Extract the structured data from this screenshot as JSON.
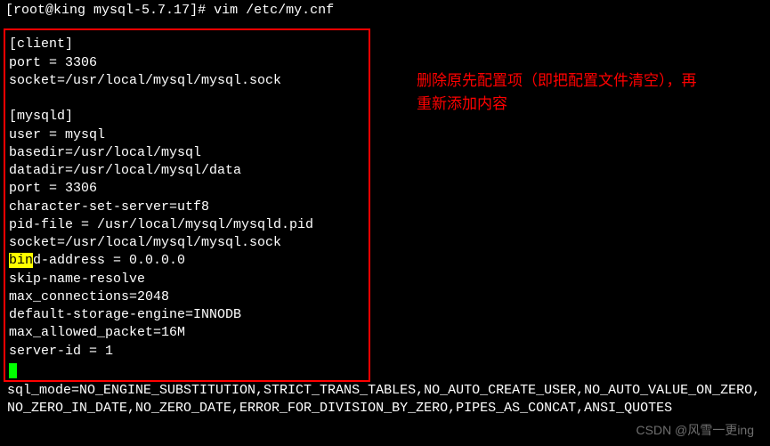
{
  "prompt": {
    "user_host": "root@king",
    "cwd": "mysql-5.7.17",
    "command": "vim /etc/my.cnf"
  },
  "config": {
    "lines": [
      "[client]",
      "port = 3306",
      "socket=/usr/local/mysql/mysql.sock",
      "",
      "[mysqld]",
      "user = mysql",
      "basedir=/usr/local/mysql",
      "datadir=/usr/local/mysql/data",
      "port = 3306",
      "character-set-server=utf8",
      "pid-file = /usr/local/mysql/mysqld.pid",
      "socket=/usr/local/mysql/mysql.sock"
    ],
    "bind_hl": "bin",
    "bind_rest": "d-address = 0.0.0.0",
    "lines_after": [
      "skip-name-resolve",
      "max_connections=2048",
      "default-storage-engine=INNODB",
      "max_allowed_packet=16M",
      "server-id = 1"
    ],
    "sql_mode": "sql_mode=NO_ENGINE_SUBSTITUTION,STRICT_TRANS_TABLES,NO_AUTO_CREATE_USER,NO_AUTO_VALUE_ON_ZERO,NO_ZERO_IN_DATE,NO_ZERO_DATE,ERROR_FOR_DIVISION_BY_ZERO,PIPES_AS_CONCAT,ANSI_QUOTES"
  },
  "annotation": {
    "line1": "删除原先配置项（即把配置文件清空），再",
    "line2": "重新添加内容"
  },
  "watermark": "CSDN @风雪一更ing"
}
